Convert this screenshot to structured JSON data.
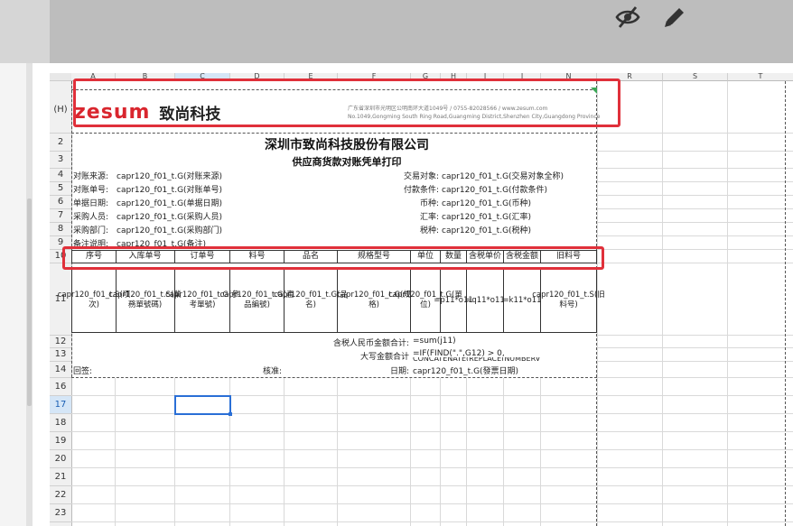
{
  "columns": [
    "A",
    "B",
    "C",
    "D",
    "E",
    "F",
    "G",
    "H",
    "I",
    "J",
    "N",
    "R",
    "S",
    "T"
  ],
  "rows": [
    "...",
    "2",
    "3",
    "4",
    "5",
    "6",
    "7",
    "8",
    "9",
    "10",
    "11",
    "12",
    "13",
    "14",
    "16",
    "17",
    "18",
    "19",
    "20",
    "21",
    "22",
    "23",
    "24"
  ],
  "header_row": {
    "marker": "(H)",
    "logo_en": "zesum",
    "logo_cn": "致尚科技",
    "address_cn": "广东省深圳市光明区公明南环大道1049号  /  0755-82028566  /  www.zesum.com",
    "address_en": "No.1049,Gongming South Ring Road,Guangming District,Shenzhen City,Guangdong Province"
  },
  "company_title": "深圳市致尚科技股份有限公司",
  "report_title": "供应商货款对账凭单打印",
  "info_left": [
    {
      "label": "对账来源:",
      "value": "capr120_f01_t.G(对账来源)"
    },
    {
      "label": "对账单号:",
      "value": "capr120_f01_t.G(对账单号)"
    },
    {
      "label": "单据日期:",
      "value": "capr120_f01_t.G(单据日期)"
    },
    {
      "label": "采购人员:",
      "value": "capr120_f01_t.G(采购人员)"
    },
    {
      "label": "采购部门:",
      "value": "capr120_f01_t.G(采购部门)"
    },
    {
      "label": "备注说明:",
      "value": "capr120_f01_t.G(备注)"
    }
  ],
  "info_right": [
    {
      "label": "交易对象:",
      "value": "capr120_f01_t.G(交易对象全称)"
    },
    {
      "label": "付款条件:",
      "value": "capr120_f01_t.G(付款条件)"
    },
    {
      "label": "币种:",
      "value": "capr120_f01_t.G(币种)"
    },
    {
      "label": "汇率:",
      "value": "capr120_f01_t.G(汇率)"
    },
    {
      "label": "税种:",
      "value": "capr120_f01_t.G(税种)"
    }
  ],
  "table_headers": [
    "序号",
    "入库单号",
    "订单号",
    "料号",
    "品名",
    "规格型号",
    "单位",
    "数量",
    "含税单价",
    "含税金额",
    "旧料号"
  ],
  "table_body": [
    "capr120_f01_t.S(项次)",
    "capr120_f01_t.S(業務單號碼)",
    "capr120_f01_t.G(參考單號)",
    "capr120_f01_t.G(產品編號)",
    "capr120_f01_t.G(品名)",
    "capr120_f01_t.G(规格)",
    "capr120_f01_t.G(單位)",
    "=p11*o11",
    "=q11*o11",
    "=k11*o11",
    "capr120_f01_t.S(旧料号)"
  ],
  "totals": {
    "rmb_label": "含税人民币金额合计:",
    "rmb_formula": "=sum(j11)",
    "cap_label": "大写金额合计",
    "cap_formula": "=IF(FIND(\".\",G12) > 0,",
    "cap_formula2": "CONCATENATE(REPLACE(NUMBERV"
  },
  "footer": {
    "sign_label": "回签:",
    "approve_label": "核准:",
    "date_label": "日期:",
    "date_value": "capr120_f01_t.G(發票日期)"
  },
  "colors": {
    "accent_red": "#e0303a",
    "logo_red": "#d9262e",
    "selection_blue": "#2a6fd6"
  },
  "icons": [
    "eye-off-icon",
    "pencil-icon"
  ]
}
